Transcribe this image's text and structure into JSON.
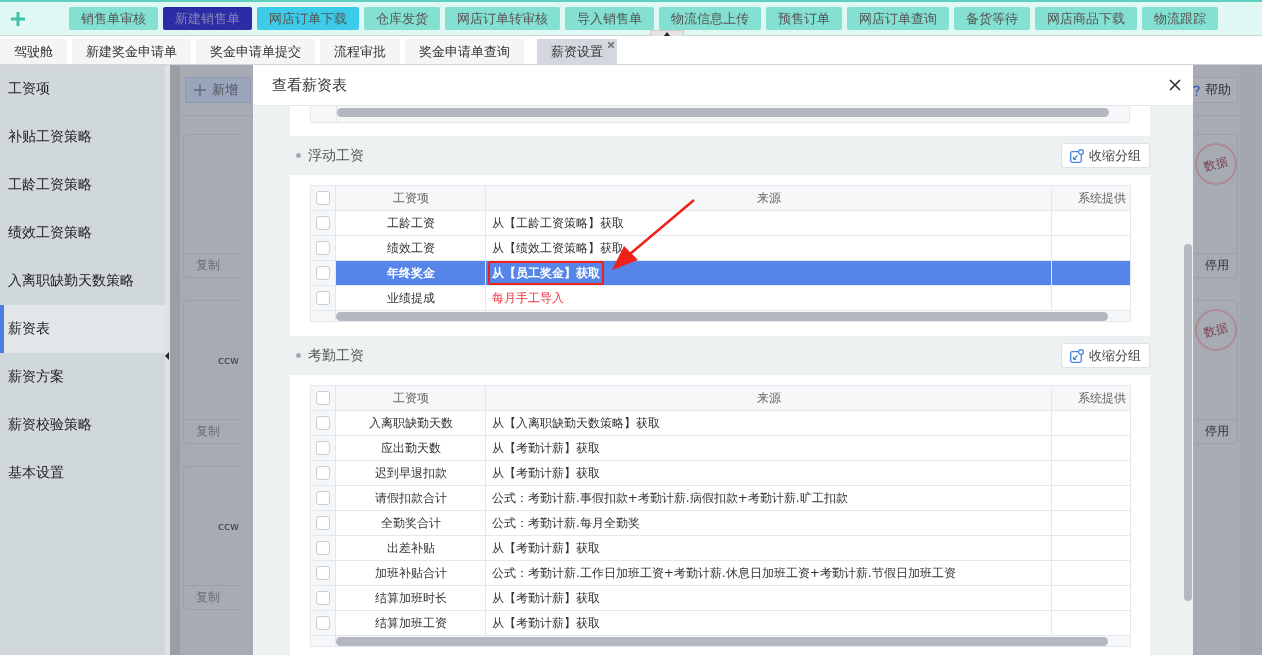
{
  "top_menu": {
    "buttons": [
      {
        "label": "销售单审核",
        "kind": "normal"
      },
      {
        "label": "新建销售单",
        "kind": "active"
      },
      {
        "label": "网店订单下载",
        "kind": "hover"
      },
      {
        "label": "仓库发货",
        "kind": "normal"
      },
      {
        "label": "网店订单转审核",
        "kind": "normal"
      },
      {
        "label": "导入销售单",
        "kind": "normal"
      },
      {
        "label": "物流信息上传",
        "kind": "normal"
      },
      {
        "label": "预售订单",
        "kind": "normal"
      },
      {
        "label": "网店订单查询",
        "kind": "normal"
      },
      {
        "label": "备货等待",
        "kind": "normal"
      },
      {
        "label": "网店商品下载",
        "kind": "normal"
      },
      {
        "label": "物流跟踪",
        "kind": "normal"
      }
    ]
  },
  "tab_bar": {
    "tabs": [
      {
        "label": "驾驶舱",
        "selected": false,
        "closable": false
      },
      {
        "label": "新建奖金申请单",
        "selected": false,
        "closable": false
      },
      {
        "label": "奖金申请单提交",
        "selected": false,
        "closable": false
      },
      {
        "label": "流程审批",
        "selected": false,
        "closable": false
      },
      {
        "label": "奖金申请单查询",
        "selected": false,
        "closable": false
      },
      {
        "label": "薪资设置",
        "selected": true,
        "closable": true
      }
    ]
  },
  "sidebar": {
    "items": [
      {
        "label": "工资项",
        "selected": false
      },
      {
        "label": "补贴工资策略",
        "selected": false
      },
      {
        "label": "工龄工资策略",
        "selected": false
      },
      {
        "label": "绩效工资策略",
        "selected": false
      },
      {
        "label": "入离职缺勤天数策略",
        "selected": false
      },
      {
        "label": "薪资表",
        "selected": true
      },
      {
        "label": "薪资方案",
        "selected": false
      },
      {
        "label": "薪资校验策略",
        "selected": false
      },
      {
        "label": "基本设置",
        "selected": false
      }
    ]
  },
  "background_page": {
    "add_button": "新增",
    "help_button": "帮助",
    "left_cards": [
      {
        "footer": "复制"
      },
      {
        "label": "ccw",
        "footer": "复制"
      },
      {
        "label": "ccw",
        "footer": "复制"
      }
    ],
    "right_cards": [
      {
        "stamp": "数据",
        "footer": "停用"
      },
      {
        "stamp": "数据",
        "footer": "停用"
      }
    ]
  },
  "dialog": {
    "title": "查看薪资表",
    "groups": [
      {
        "title": "浮动工资",
        "collapse_button": "收缩分组",
        "columns": [
          "工资项",
          "来源",
          "系统提供"
        ],
        "all_checked": false,
        "rows": [
          {
            "item": "工龄工资",
            "source": "从【工龄工资策略】获取",
            "selected": false,
            "checked": false,
            "manual": false,
            "annotated": false
          },
          {
            "item": "绩效工资",
            "source": "从【绩效工资策略】获取",
            "selected": false,
            "checked": false,
            "manual": false,
            "annotated": false
          },
          {
            "item": "年终奖金",
            "source": "从【员工奖金】获取",
            "selected": true,
            "checked": false,
            "manual": false,
            "annotated": true
          },
          {
            "item": "业绩提成",
            "source": "每月手工导入",
            "selected": false,
            "checked": false,
            "manual": true,
            "annotated": false
          }
        ]
      },
      {
        "title": "考勤工资",
        "collapse_button": "收缩分组",
        "columns": [
          "工资项",
          "来源",
          "系统提供"
        ],
        "all_checked": false,
        "rows": [
          {
            "item": "入离职缺勤天数",
            "source": "从【入离职缺勤天数策略】获取",
            "selected": false,
            "checked": false,
            "manual": false,
            "annotated": false
          },
          {
            "item": "应出勤天数",
            "source": "从【考勤计薪】获取",
            "selected": false,
            "checked": false,
            "manual": false,
            "annotated": false
          },
          {
            "item": "迟到早退扣款",
            "source": "从【考勤计薪】获取",
            "selected": false,
            "checked": false,
            "manual": false,
            "annotated": false
          },
          {
            "item": "请假扣款合计",
            "source": "公式：考勤计薪.事假扣款+考勤计薪.病假扣款+考勤计薪.旷工扣款",
            "selected": false,
            "checked": false,
            "manual": false,
            "annotated": false
          },
          {
            "item": "全勤奖合计",
            "source": "公式：考勤计薪.每月全勤奖",
            "selected": false,
            "checked": false,
            "manual": false,
            "annotated": false
          },
          {
            "item": "出差补贴",
            "source": "从【考勤计薪】获取",
            "selected": false,
            "checked": false,
            "manual": false,
            "annotated": false
          },
          {
            "item": "加班补贴合计",
            "source": "公式：考勤计薪.工作日加班工资+考勤计薪.休息日加班工资+考勤计薪.节假日加班工资",
            "selected": false,
            "checked": false,
            "manual": false,
            "annotated": false
          },
          {
            "item": "结算加班时长",
            "source": "从【考勤计薪】获取",
            "selected": false,
            "checked": false,
            "manual": false,
            "annotated": false
          },
          {
            "item": "结算加班工资",
            "source": "从【考勤计薪】获取",
            "selected": false,
            "checked": false,
            "manual": false,
            "annotated": false
          }
        ]
      }
    ]
  }
}
